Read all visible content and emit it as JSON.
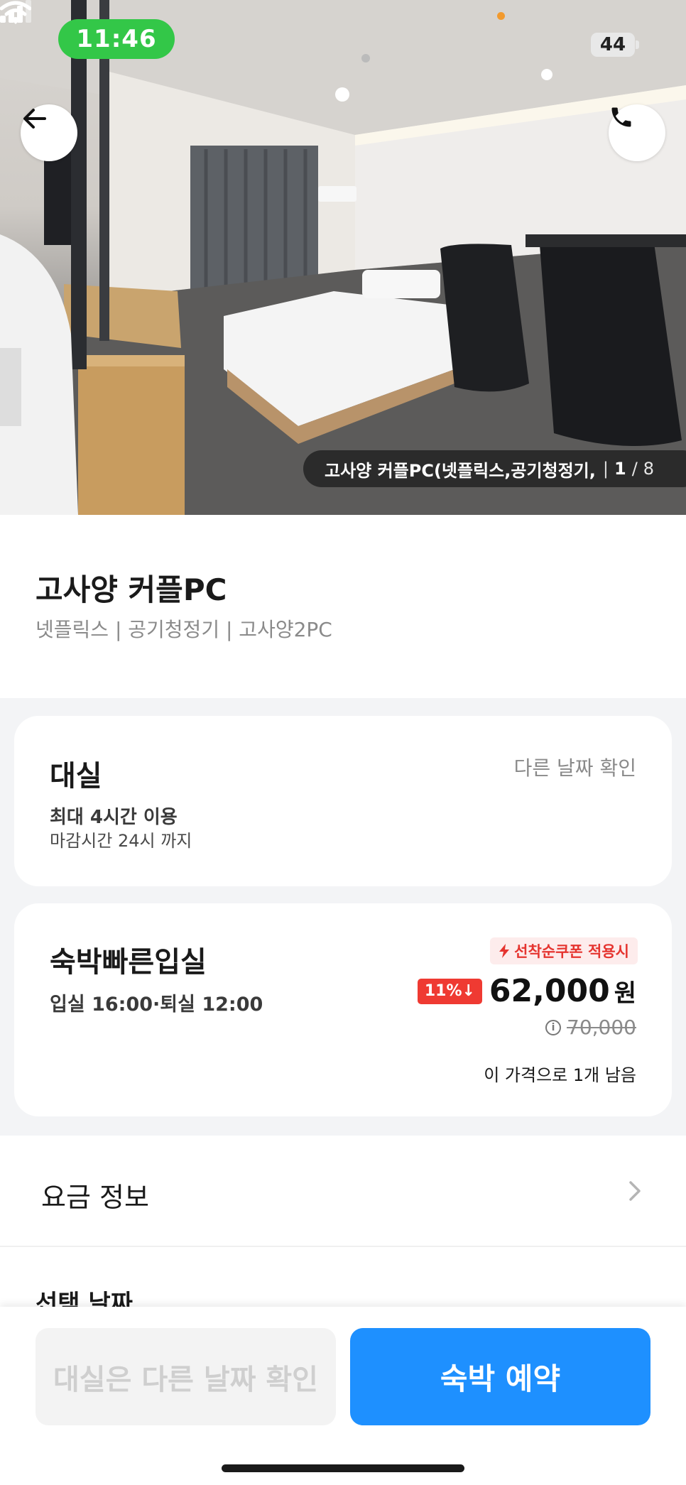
{
  "status": {
    "time": "11:46",
    "battery": "44"
  },
  "hero": {
    "caption": "고사양 커플PC(넷플릭스,공기청정기,",
    "photo_index": "1",
    "photo_separator": "/",
    "photo_total": "8"
  },
  "room": {
    "title": "고사양 커플PC",
    "tags": "넷플릭스 | 공기청정기 | 고사양2PC"
  },
  "daystay": {
    "title": "대실",
    "other_date": "다른 날짜 확인",
    "max_use": "최대 4시간 이용",
    "deadline": "마감시간 24시 까지"
  },
  "overnight": {
    "title": "숙박빠른입실",
    "checkin_out": "입실 16:00·퇴실 12:00",
    "coupon": "선착순쿠폰 적용시",
    "discount": "11%↓",
    "price": "62,000",
    "currency": "원",
    "original_price": "70,000",
    "remaining": "이 가격으로 1개 남음"
  },
  "fee_info": {
    "label": "요금 정보"
  },
  "select_date": {
    "label": "선택 날짜"
  },
  "bottom": {
    "other_date_button": "대실은 다른 날짜 확인",
    "book_button": "숙박 예약"
  },
  "colors": {
    "status_green": "#33c748",
    "primary_blue": "#1e90ff",
    "discount_red": "#ef3a32",
    "coupon_red": "#e5342f"
  }
}
